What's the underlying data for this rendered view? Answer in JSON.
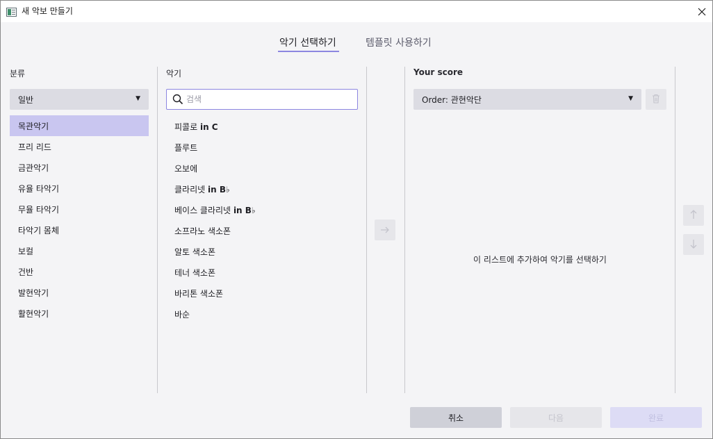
{
  "window": {
    "title": "새 악보 만들기"
  },
  "tabs": [
    {
      "label": "악기 선택하기",
      "active": true
    },
    {
      "label": "템플릿 사용하기",
      "active": false
    }
  ],
  "categories": {
    "label": "분류",
    "dropdown_value": "일반",
    "items": [
      {
        "label": "목관악기",
        "selected": true
      },
      {
        "label": "프리 리드"
      },
      {
        "label": "금관악기"
      },
      {
        "label": "유율 타악기"
      },
      {
        "label": "무율 타악기"
      },
      {
        "label": "타악기 몸체"
      },
      {
        "label": "보컬"
      },
      {
        "label": "건반"
      },
      {
        "label": "발현악기"
      },
      {
        "label": "활현악기"
      }
    ]
  },
  "instruments": {
    "label": "악기",
    "search_placeholder": "검색",
    "items": [
      {
        "name": "피콜로",
        "suffix": "in C"
      },
      {
        "name": "플루트",
        "suffix": ""
      },
      {
        "name": "오보에",
        "suffix": ""
      },
      {
        "name": "클라리넷",
        "suffix": "in B♭"
      },
      {
        "name": "베이스 클라리넷",
        "suffix": "in B♭"
      },
      {
        "name": "소프라노 색소폰",
        "suffix": ""
      },
      {
        "name": "알토 색소폰",
        "suffix": ""
      },
      {
        "name": "테너 색소폰",
        "suffix": ""
      },
      {
        "name": "바리톤 색소폰",
        "suffix": ""
      },
      {
        "name": "바순",
        "suffix": ""
      }
    ]
  },
  "score": {
    "label": "Your score",
    "order_value": "Order: 관현악단",
    "empty_message": "이 리스트에 추가하여 악기를 선택하기"
  },
  "footer": {
    "cancel": "취소",
    "next": "다음",
    "done": "완료"
  },
  "colors": {
    "accent": "#8c86e0",
    "selected_row": "#c9c6f0",
    "background": "#f4f4f6"
  }
}
